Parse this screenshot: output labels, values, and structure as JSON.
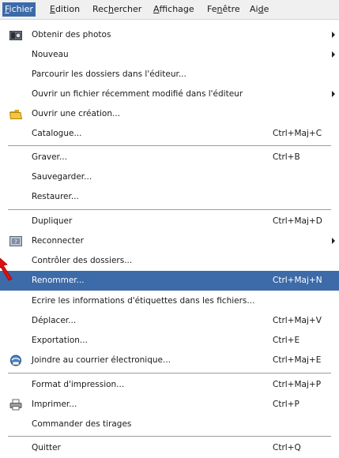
{
  "menubar": {
    "items": [
      {
        "prefix": "",
        "mnemonic": "F",
        "rest": "ichier"
      },
      {
        "prefix": "",
        "mnemonic": "E",
        "rest": "dition"
      },
      {
        "prefix": "Rec",
        "mnemonic": "h",
        "rest": "ercher"
      },
      {
        "prefix": "",
        "mnemonic": "A",
        "rest": "ffichage"
      },
      {
        "prefix": "Fe",
        "mnemonic": "n",
        "rest": "être"
      },
      {
        "prefix": "Ai",
        "mnemonic": "d",
        "rest": "e"
      }
    ]
  },
  "menu": {
    "items": [
      {
        "label": "Obtenir des photos",
        "shortcut": "",
        "icon": "camera-icon"
      },
      {
        "label": "Nouveau",
        "shortcut": ""
      },
      {
        "label": "Parcourir les dossiers dans l'éditeur...",
        "shortcut": ""
      },
      {
        "label": "Ouvrir un fichier récemment modifié dans l'éditeur",
        "shortcut": ""
      },
      {
        "label": "Ouvrir une création...",
        "shortcut": "",
        "icon": "folder-open-icon"
      },
      {
        "label": "Catalogue...",
        "shortcut": "Ctrl+Maj+C"
      },
      {
        "label": "Graver...",
        "shortcut": "Ctrl+B"
      },
      {
        "label": "Sauvegarder...",
        "shortcut": ""
      },
      {
        "label": "Restaurer...",
        "shortcut": ""
      },
      {
        "label": "Dupliquer",
        "shortcut": "Ctrl+Maj+D"
      },
      {
        "label": "Reconnecter",
        "shortcut": "",
        "icon": "reconnect-icon"
      },
      {
        "label": "Contrôler des dossiers...",
        "shortcut": ""
      },
      {
        "label": "Renommer...",
        "shortcut": "Ctrl+Maj+N"
      },
      {
        "label": "Ecrire les informations d'étiquettes dans les fichiers...",
        "shortcut": ""
      },
      {
        "label": "Déplacer...",
        "shortcut": "Ctrl+Maj+V"
      },
      {
        "label": "Exportation...",
        "shortcut": "Ctrl+E"
      },
      {
        "label": "Joindre au courrier électronique...",
        "shortcut": "Ctrl+Maj+E",
        "icon": "email-icon"
      },
      {
        "label": "Format d'impression...",
        "shortcut": "Ctrl+Maj+P"
      },
      {
        "label": "Imprimer...",
        "shortcut": "Ctrl+P",
        "icon": "printer-icon"
      },
      {
        "label": "Commander des tirages",
        "shortcut": ""
      },
      {
        "label": "Quitter",
        "shortcut": "Ctrl+Q"
      }
    ]
  },
  "colors": {
    "highlight": "#3d6aa9",
    "pointer": "#e01010"
  }
}
